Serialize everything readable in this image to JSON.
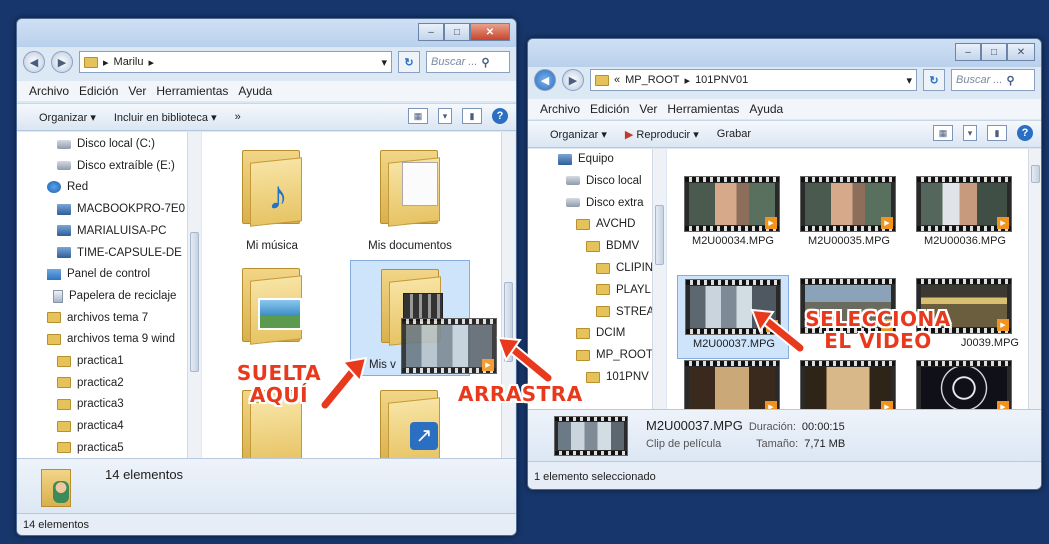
{
  "left_window": {
    "caption_buttons": {
      "minimize": "–",
      "maximize": "□",
      "close": "✕"
    },
    "path": [
      "Marilu"
    ],
    "search_placeholder": "Buscar ...",
    "menu": [
      "Archivo",
      "Edición",
      "Ver",
      "Herramientas",
      "Ayuda"
    ],
    "toolbar": {
      "organize": "Organizar ▾",
      "include": "Incluir en biblioteca ▾",
      "more": "»"
    },
    "nav_tree": [
      {
        "label": "Disco local (C:)",
        "icon": "drive-icon"
      },
      {
        "label": "Disco extraíble (E:)",
        "icon": "drive-icon"
      },
      {
        "label": "Red",
        "icon": "network-icon"
      },
      {
        "label": "MACBOOKPRO-7E0",
        "icon": "computer-icon"
      },
      {
        "label": "MARIALUISA-PC",
        "icon": "computer-icon"
      },
      {
        "label": "TIME-CAPSULE-DE",
        "icon": "computer-icon"
      },
      {
        "label": "Panel de control",
        "icon": "control-panel-icon"
      },
      {
        "label": "Papelera de reciclaje",
        "icon": "recycle-bin-icon"
      },
      {
        "label": "archivos tema 7",
        "icon": "folder-icon"
      },
      {
        "label": "archivos tema 9 wind",
        "icon": "folder-icon"
      },
      {
        "label": "practica1",
        "icon": "folder-icon"
      },
      {
        "label": "practica2",
        "icon": "folder-icon"
      },
      {
        "label": "practica3",
        "icon": "folder-icon"
      },
      {
        "label": "practica4",
        "icon": "folder-icon"
      },
      {
        "label": "practica5",
        "icon": "folder-icon"
      }
    ],
    "folders": [
      {
        "label": "Mi música",
        "overlay": "music-note-icon"
      },
      {
        "label": "Mis documentos",
        "overlay": "document-icon"
      },
      {
        "label": "",
        "overlay": "picture-icon"
      },
      {
        "label": "Mis v",
        "overlay": "video-icon"
      },
      {
        "label": "",
        "overlay": "none"
      },
      {
        "label": "",
        "overlay": "shortcut-icon"
      }
    ],
    "details_count": "14 elementos",
    "status": "14 elementos"
  },
  "right_window": {
    "path": [
      "«",
      "MP_ROOT",
      "101PNV01"
    ],
    "search_placeholder": "Buscar ...",
    "menu": [
      "Archivo",
      "Edición",
      "Ver",
      "Herramientas",
      "Ayuda"
    ],
    "toolbar": {
      "organize": "Organizar ▾",
      "play": "Reproducir ▾",
      "burn": "Grabar"
    },
    "nav_tree": [
      {
        "label": "Equipo",
        "icon": "computer-icon"
      },
      {
        "label": "Disco local",
        "icon": "drive-icon"
      },
      {
        "label": "Disco extra",
        "icon": "drive-icon"
      },
      {
        "label": "AVCHD",
        "icon": "folder-icon"
      },
      {
        "label": "BDMV",
        "icon": "folder-icon"
      },
      {
        "label": "CLIPIN",
        "icon": "folder-icon"
      },
      {
        "label": "PLAYLI",
        "icon": "folder-icon"
      },
      {
        "label": "STREA",
        "icon": "folder-icon"
      },
      {
        "label": "DCIM",
        "icon": "folder-icon"
      },
      {
        "label": "MP_ROOT",
        "icon": "folder-icon"
      },
      {
        "label": "101PNV",
        "icon": "folder-icon"
      }
    ],
    "videos": [
      {
        "label": "M2U00034.MPG",
        "scene": "person-train"
      },
      {
        "label": "M2U00035.MPG",
        "scene": "person-train"
      },
      {
        "label": "M2U00036.MPG",
        "scene": "person-reading"
      },
      {
        "label": "M2U00037.MPG",
        "scene": "train-interior"
      },
      {
        "label": "",
        "scene": "street"
      },
      {
        "label": "J0039.MPG",
        "scene": "station"
      },
      {
        "label": "",
        "scene": "corridor"
      },
      {
        "label": "",
        "scene": "hallway"
      },
      {
        "label": "",
        "scene": "ferris-wheel"
      }
    ],
    "details": {
      "filename": "M2U00037.MPG",
      "duration_label": "Duración:",
      "duration": "00:00:15",
      "type": "Clip de película",
      "size_label": "Tamaño:",
      "size": "7,71 MB"
    },
    "status": "1 elemento seleccionado"
  },
  "annotations": {
    "drop": [
      "SUELTA",
      "AQUÍ"
    ],
    "drag": "ARRASTRA",
    "select": [
      "SELECCIONA",
      "EL VIDEO"
    ]
  },
  "colors": {
    "desktop": "#17366b",
    "callout": "#e8391c",
    "selection": "#cde4fb"
  }
}
